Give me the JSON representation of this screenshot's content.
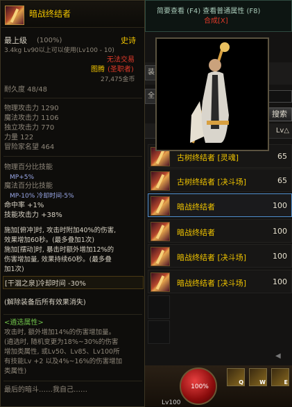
{
  "tooltip": {
    "name": "暗战终结者",
    "grade": "最上级",
    "grade_pct": "(100%)",
    "rarity": "史诗",
    "weight_req": "3.4kg  Lv90以上可以使用(Lv100 - 10)",
    "trade": "无法交易",
    "type": "图腾",
    "job": "(圣职者)",
    "price": "27,475金币",
    "durability": "耐久度 48/48",
    "stats": [
      "物理攻击力 1290",
      "魔法攻击力 1106",
      "独立攻击力 770",
      "力量 122",
      "冒险家名望 464"
    ],
    "percent_title": "物理百分比技能",
    "percent_mp": "MP+5%",
    "magic_title": "魔法百分比技能",
    "magic_mp": "MP-10% 冷却时间-5%",
    "hit": "命中率 +1%",
    "skill_atk": "技能攻击力 +38%",
    "effect1": [
      "施加[俯冲]时, 攻击时附加40%的伤害,",
      "效果增加60秒。(最多叠加1次)",
      "施加[摆动]时, 暴击时额外增加12%的",
      "伤害增加量, 效果持续60秒。(最多叠",
      "加1次)"
    ],
    "spring": "[干涸之泉]冷却时间 -30%",
    "remove": "(解除装备后所有效果消失)",
    "option_title": "<遴选属性>",
    "option_text": [
      "攻击时, 额外增加14%的伤害增加量。",
      "(遴选时, 随机变更为18%~30%的伤害",
      "增加类属性, 或Lv50、Lv85、Lv100所",
      "有技能Lv +2 以及4%~16%的伤害增加",
      "类属性)"
    ],
    "flavor": "最后的暗斗……我自己……"
  },
  "right": {
    "top_links": "简要查看 (F4) 查看普通属性 (F8)",
    "synthesize": "合成[X]",
    "side_tabs": [
      "装",
      "全"
    ],
    "lv_label": "Lv",
    "search": "搜索",
    "header_lv": "Lv△",
    "rows": [
      {
        "name": "古树终结者 [灵魂]",
        "lv": "65",
        "selected": false
      },
      {
        "name": "古树终结者 [决斗场]",
        "lv": "65",
        "selected": false
      },
      {
        "name": "暗战终结者",
        "lv": "100",
        "selected": true
      },
      {
        "name": "暗战终结者",
        "lv": "100",
        "selected": false
      },
      {
        "name": "暗战终结者 [决斗场]",
        "lv": "100",
        "selected": false
      },
      {
        "name": "暗战终结者 [决斗场]",
        "lv": "100",
        "selected": false
      }
    ]
  },
  "hud": {
    "hp": "100%",
    "level": "Lv100",
    "skills": [
      "Q",
      "W",
      "E"
    ]
  }
}
